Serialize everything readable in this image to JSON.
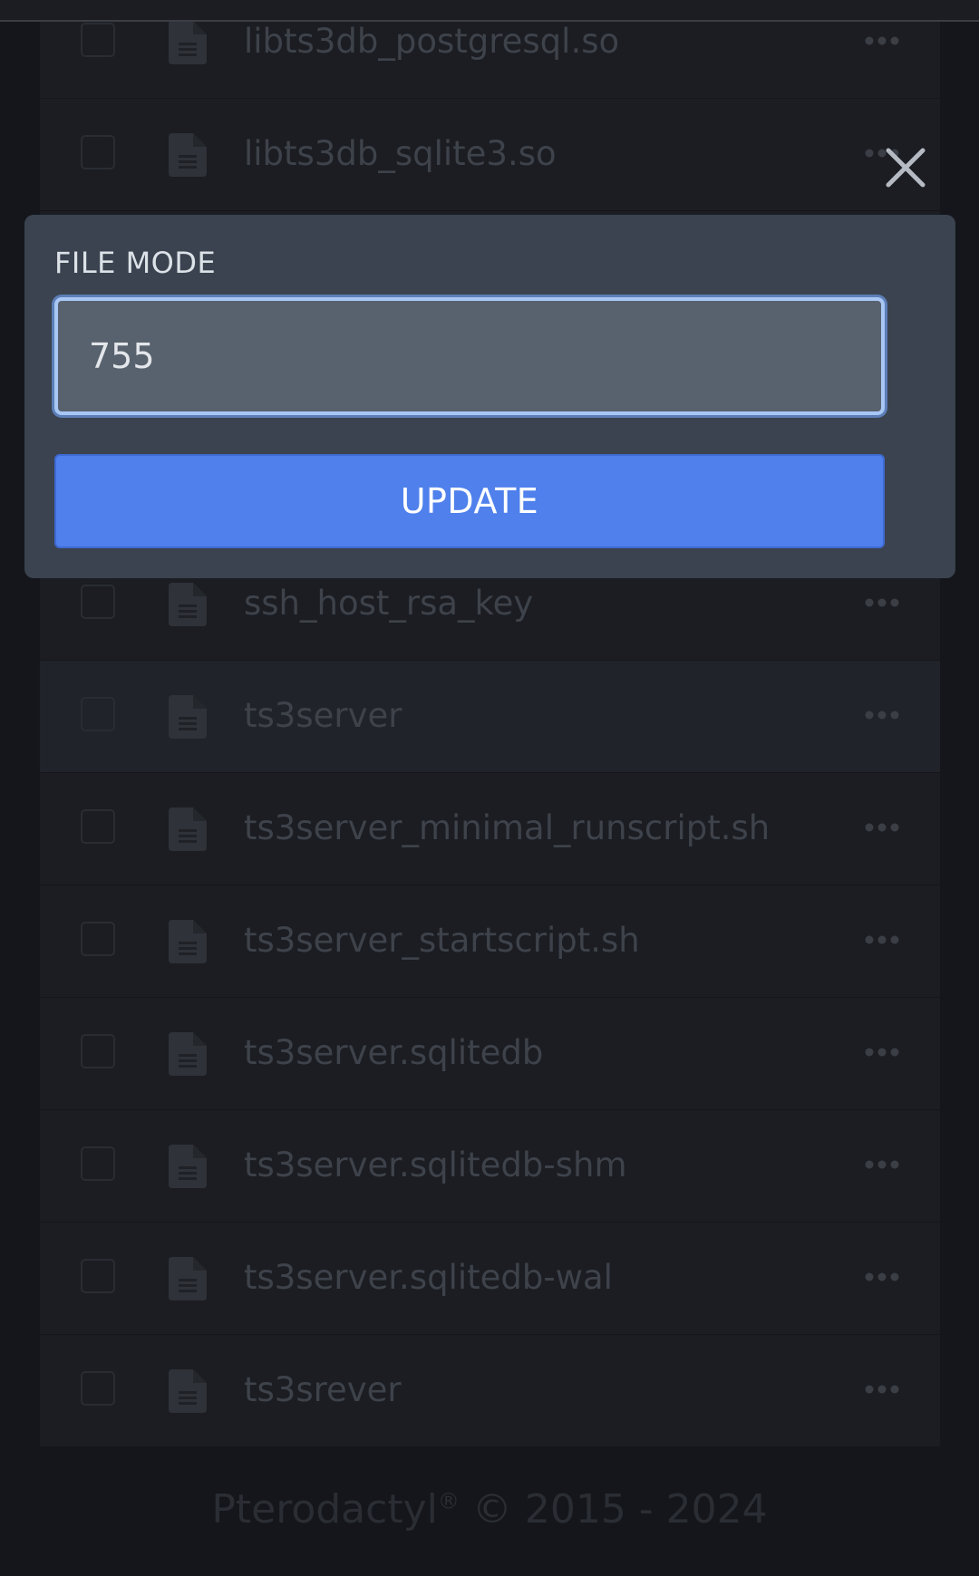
{
  "file_list": {
    "files": [
      {
        "name": "libts3db_postgresql.so"
      },
      {
        "name": "libts3db_sqlite3.so"
      },
      {
        "name": ""
      },
      {
        "name": ""
      },
      {
        "name": ""
      },
      {
        "name": "ssh_host_rsa_key"
      },
      {
        "name": "ts3server"
      },
      {
        "name": "ts3server_minimal_runscript.sh"
      },
      {
        "name": "ts3server_startscript.sh"
      },
      {
        "name": "ts3server.sqlitedb"
      },
      {
        "name": "ts3server.sqlitedb-shm"
      },
      {
        "name": "ts3server.sqlitedb-wal"
      },
      {
        "name": "ts3srever"
      }
    ]
  },
  "footer": {
    "brand": "Pterodactyl",
    "registered": "®",
    "copyright": "© 2015 - 2024"
  },
  "modal": {
    "label": "FILE MODE",
    "input_value": "755",
    "button_label": "UPDATE"
  },
  "colors": {
    "accent": "#4f80ec",
    "modal_bg": "#3a434f",
    "input_bg": "#58626e",
    "focus_ring": "#a8c7f5"
  },
  "icons": {
    "close": "close-icon",
    "file": "file-icon",
    "row_menu": "more-options-icon"
  }
}
